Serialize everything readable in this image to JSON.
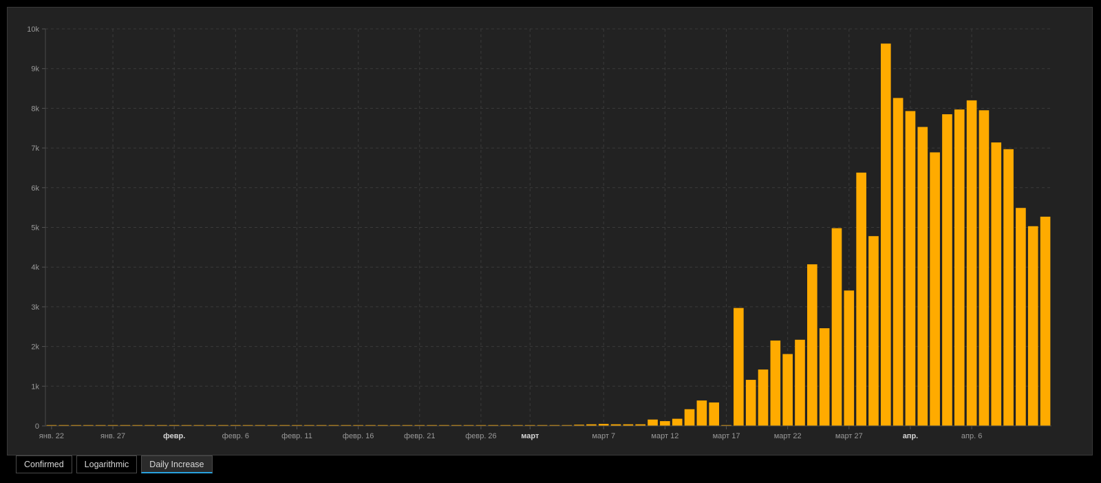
{
  "colors": {
    "bar": "#ffab00",
    "background": "#222222",
    "active_tab_underline": "#29a3e0"
  },
  "tabs": [
    {
      "label": "Confirmed",
      "active": false
    },
    {
      "label": "Logarithmic",
      "active": false
    },
    {
      "label": "Daily Increase",
      "active": true
    }
  ],
  "chart_data": {
    "type": "bar",
    "title": "",
    "xlabel": "",
    "ylabel": "",
    "ylim": [
      0,
      10000
    ],
    "grid": true,
    "legend": "none",
    "x_start": "янв. 22",
    "x_end": "апр. 6",
    "y_ticks": [
      "0",
      "1k",
      "2k",
      "3k",
      "4k",
      "5k",
      "6k",
      "7k",
      "8k",
      "9k",
      "10k"
    ],
    "x_ticks": [
      {
        "label": "янв. 22",
        "index": 0,
        "major": false
      },
      {
        "label": "янв. 27",
        "index": 5,
        "major": false
      },
      {
        "label": "февр.",
        "index": 10,
        "major": true
      },
      {
        "label": "февр. 6",
        "index": 15,
        "major": false
      },
      {
        "label": "февр. 11",
        "index": 20,
        "major": false
      },
      {
        "label": "февр. 16",
        "index": 25,
        "major": false
      },
      {
        "label": "февр. 21",
        "index": 30,
        "major": false
      },
      {
        "label": "февр. 26",
        "index": 35,
        "major": false
      },
      {
        "label": "март",
        "index": 39,
        "major": true
      },
      {
        "label": "март 7",
        "index": 45,
        "major": false
      },
      {
        "label": "март 12",
        "index": 50,
        "major": false
      },
      {
        "label": "март 17",
        "index": 55,
        "major": false
      },
      {
        "label": "март 22",
        "index": 60,
        "major": false
      },
      {
        "label": "март 27",
        "index": 65,
        "major": false
      },
      {
        "label": "апр.",
        "index": 70,
        "major": true
      },
      {
        "label": "апр. 6",
        "index": 75,
        "major": false
      }
    ],
    "series": [
      {
        "values": [
          0,
          0,
          0,
          0,
          0,
          0,
          0,
          0,
          0,
          0,
          0,
          0,
          0,
          0,
          0,
          0,
          0,
          0,
          0,
          0,
          0,
          0,
          0,
          0,
          0,
          0,
          0,
          0,
          0,
          0,
          0,
          0,
          0,
          0,
          0,
          0,
          0,
          0,
          0,
          0,
          5,
          10,
          20,
          30,
          40,
          50,
          40,
          40,
          40,
          160,
          120,
          180,
          420,
          640,
          590,
          0,
          2970,
          1160,
          1420,
          2150,
          1810,
          2170,
          4070,
          2460,
          4980,
          3410,
          6380,
          4780,
          9630,
          8260,
          7930,
          7530,
          6890,
          7850,
          7970,
          8200,
          7950,
          7140,
          6970,
          5490,
          5030,
          5270
        ]
      }
    ]
  }
}
